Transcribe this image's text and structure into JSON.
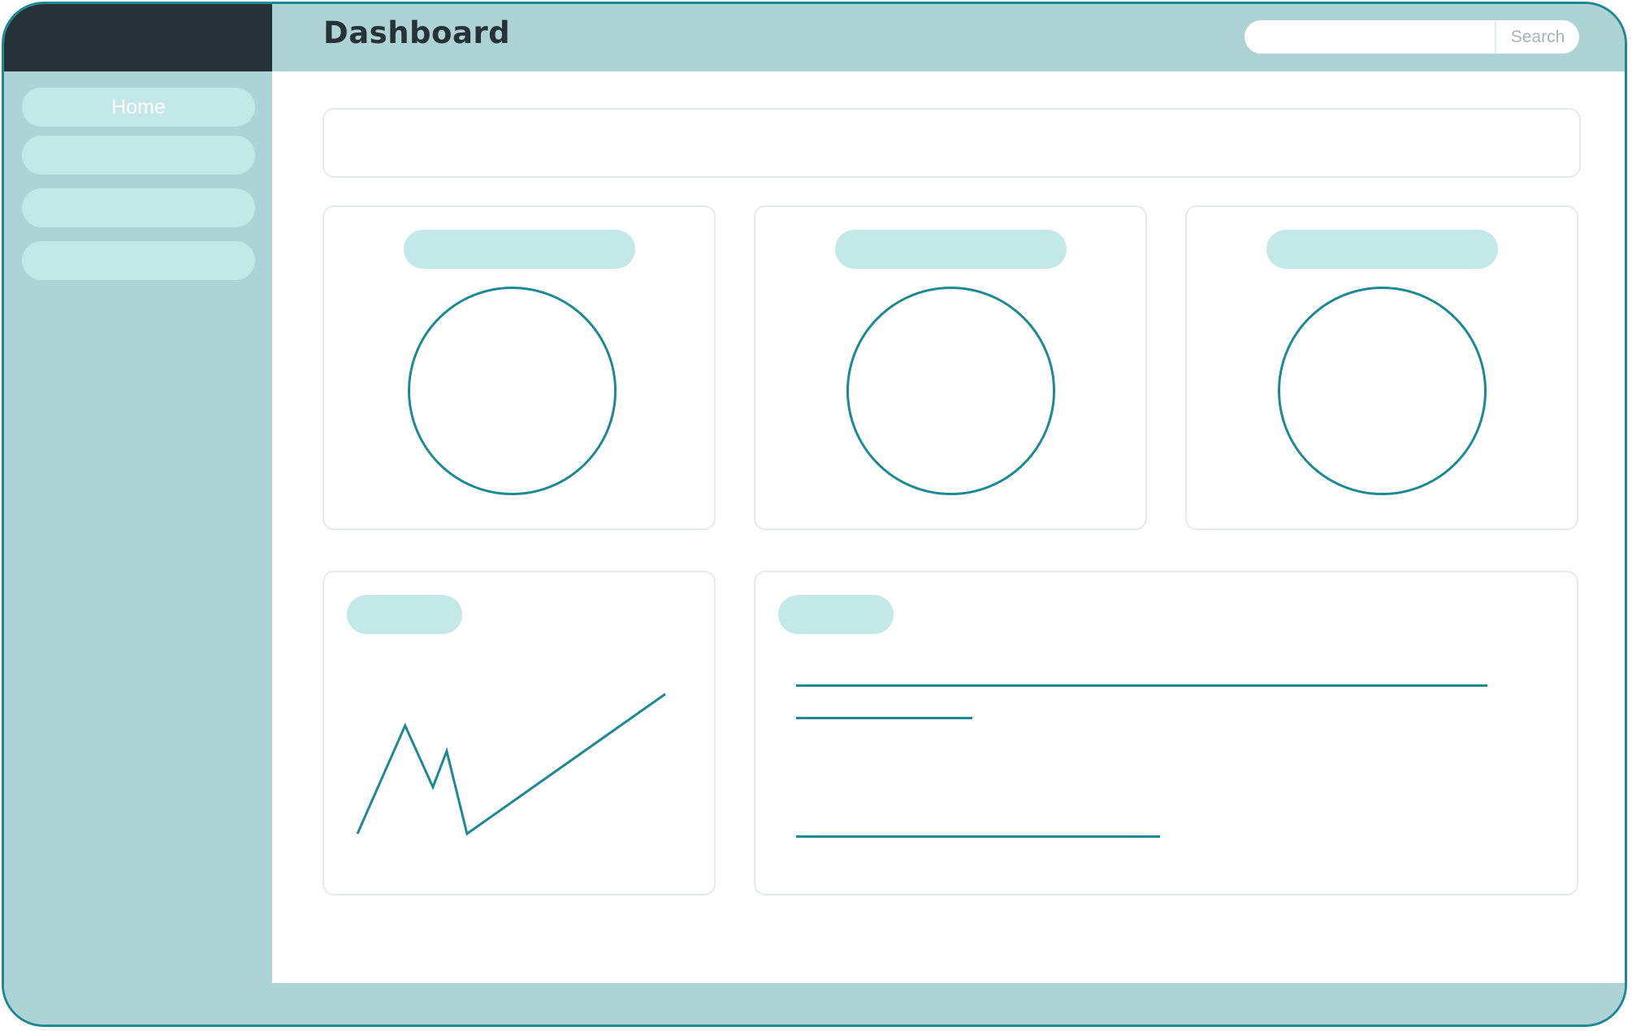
{
  "header": {
    "title": "Dashboard",
    "search": {
      "placeholder": "",
      "button_label": "Search"
    }
  },
  "sidebar": {
    "items": [
      {
        "label": "Home"
      },
      {
        "label": ""
      },
      {
        "label": ""
      },
      {
        "label": ""
      }
    ]
  },
  "colors": {
    "accent": "#1c8a94",
    "sidebar_bg": "#aed3d5",
    "nav_pill": "#c2e8e8",
    "corner_dark": "#263238"
  },
  "icons": [
    "search-icon"
  ],
  "chart_data": {
    "type": "line",
    "x": [
      1,
      2,
      3,
      4,
      5,
      6
    ],
    "series": [
      {
        "values": [
          0,
          0.72,
          0.31,
          0.55,
          0,
          0.93
        ]
      }
    ],
    "title": "",
    "xlabel": "",
    "ylabel": "",
    "ylim": [
      0,
      1
    ]
  }
}
